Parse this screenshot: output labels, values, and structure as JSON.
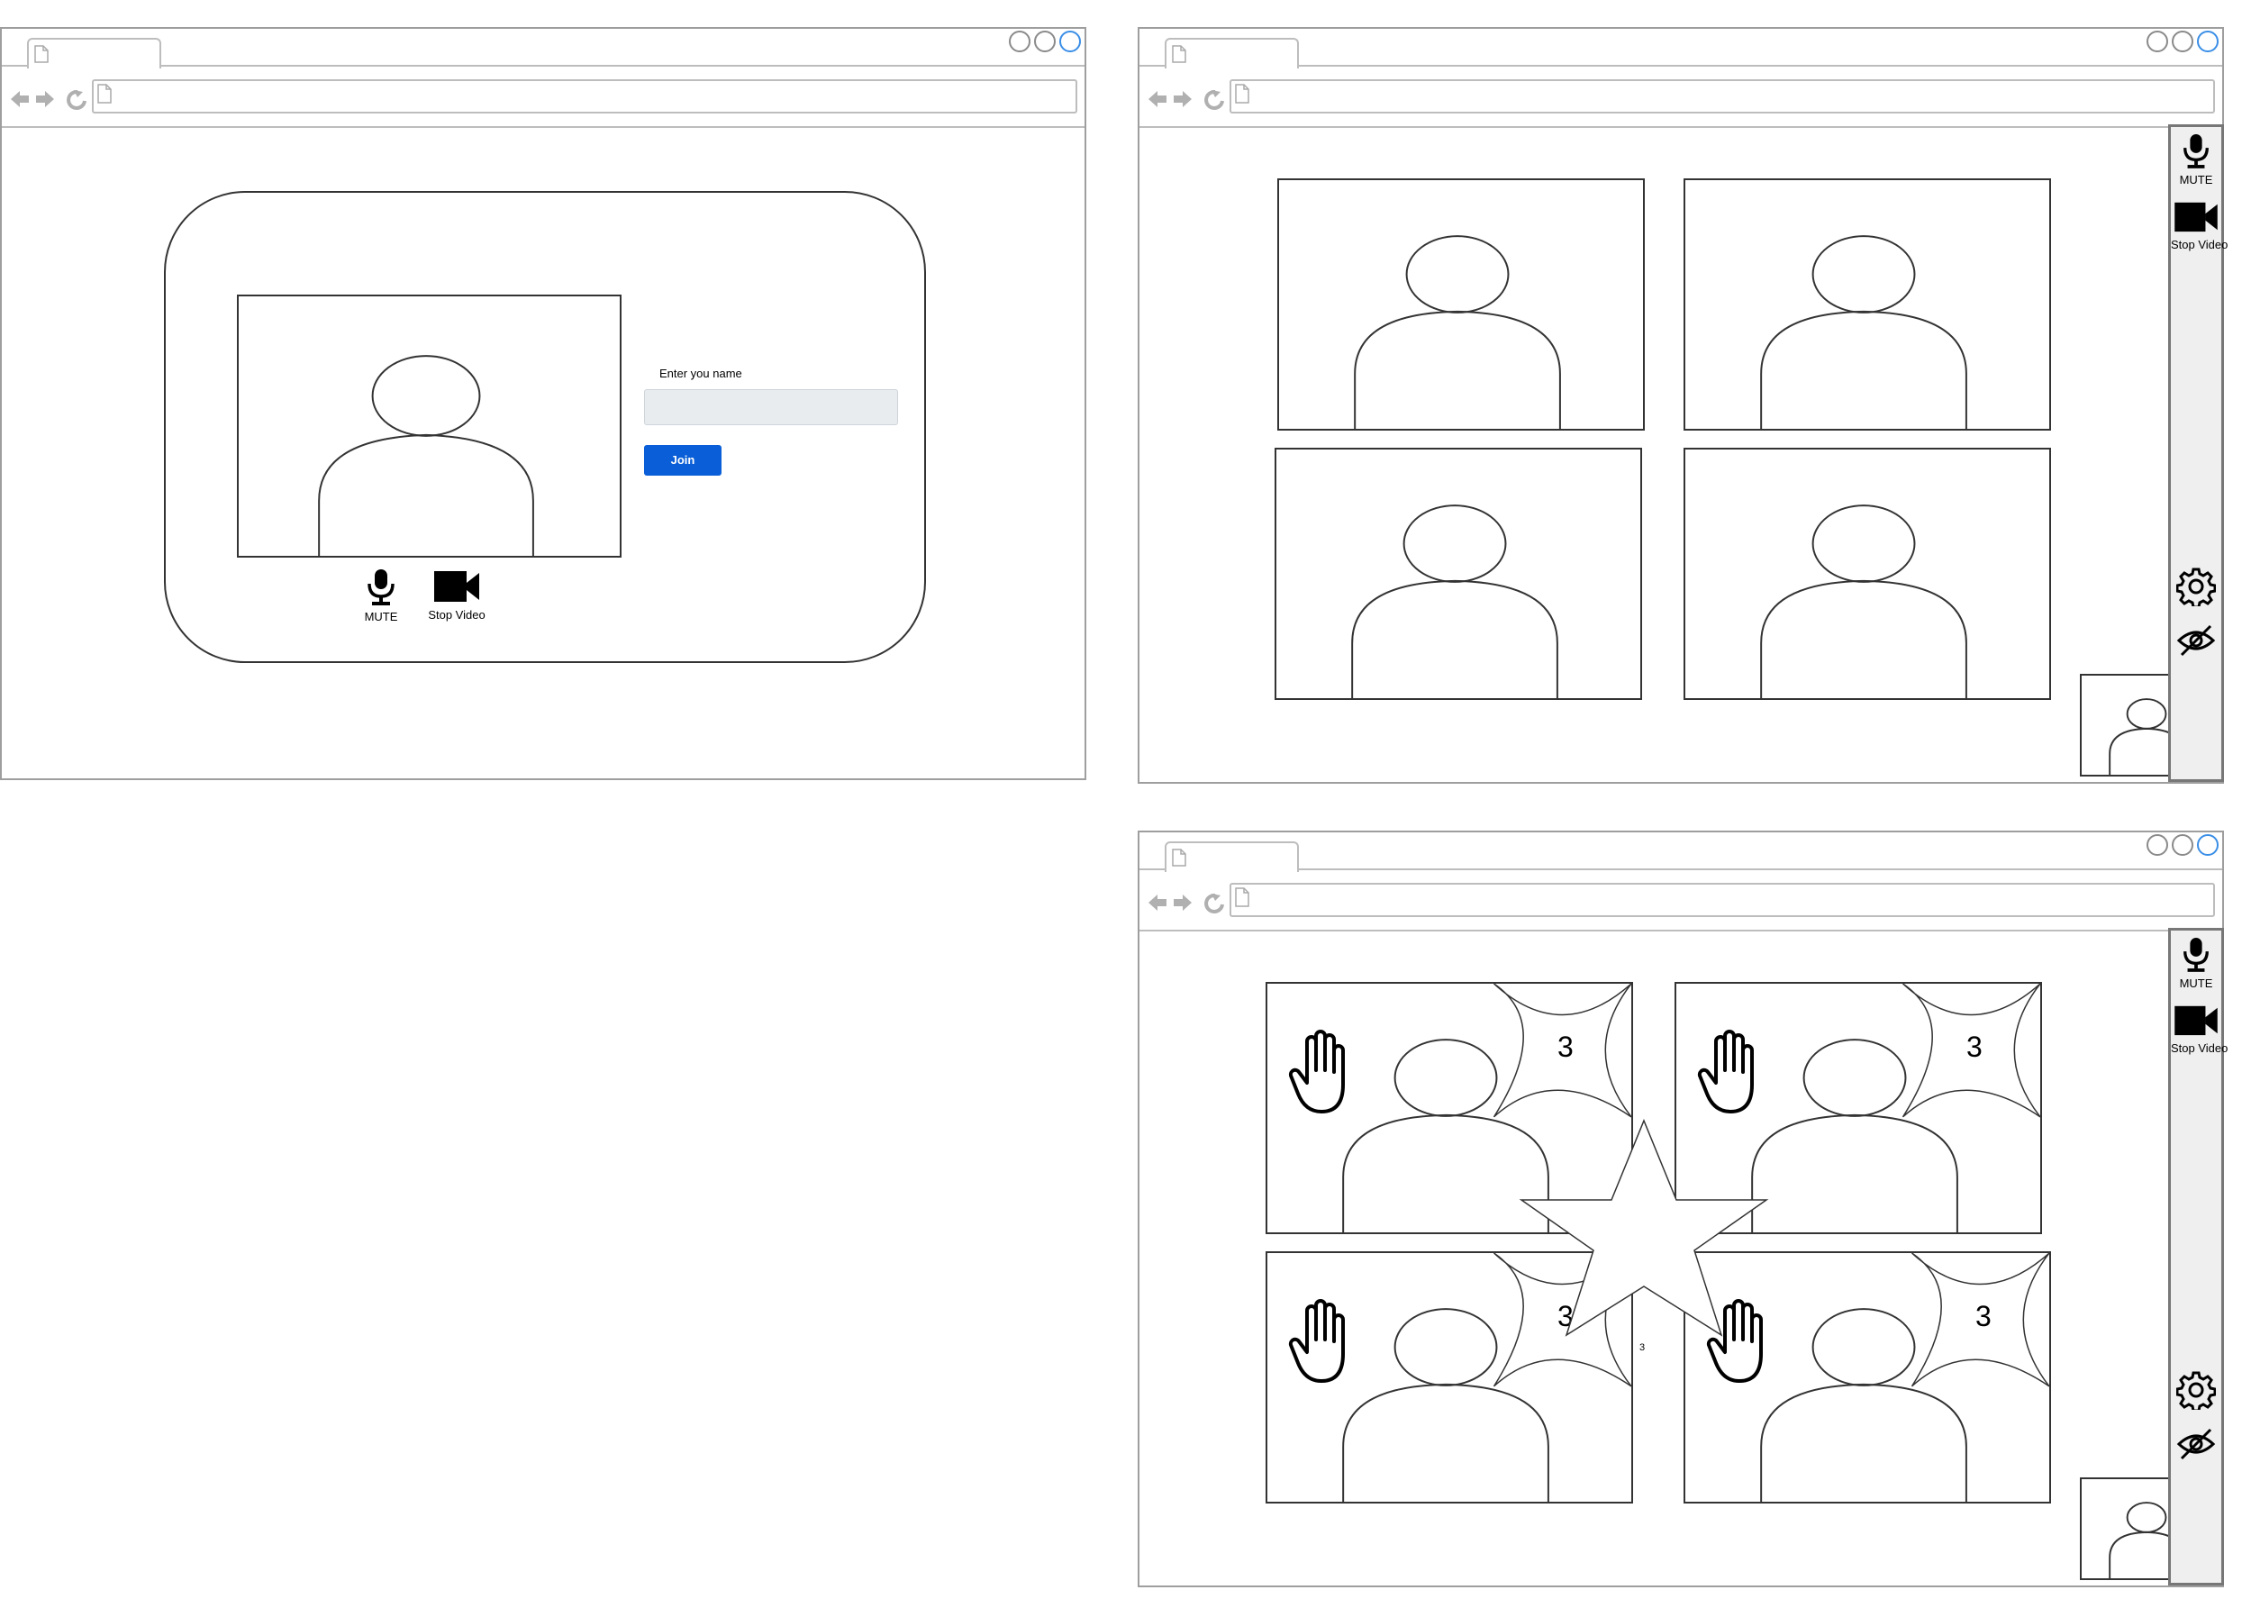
{
  "join_screen": {
    "name_label": "Enter you name",
    "name_input_value": "",
    "join_button_label": "Join",
    "mute_label": "MUTE",
    "stop_video_label": "Stop Video"
  },
  "meeting_screen": {
    "mute_label": "MUTE",
    "stop_video_label": "Stop Video"
  },
  "reactions_screen": {
    "mute_label": "MUTE",
    "stop_video_label": "Stop Video",
    "tile_counts": [
      "3",
      "3",
      "3",
      "3"
    ],
    "star_count": "3"
  },
  "colors": {
    "join_button": "#0a5fd8",
    "input_fill": "#e9ecef",
    "window_close_circle": "#3a8ee6"
  },
  "icons": [
    "page-icon",
    "back-arrow-icon",
    "forward-arrow-icon",
    "reload-icon",
    "microphone-icon",
    "video-camera-icon",
    "gear-icon",
    "eye-slash-icon",
    "raised-hand-icon",
    "star-icon",
    "user-silhouette-icon"
  ]
}
